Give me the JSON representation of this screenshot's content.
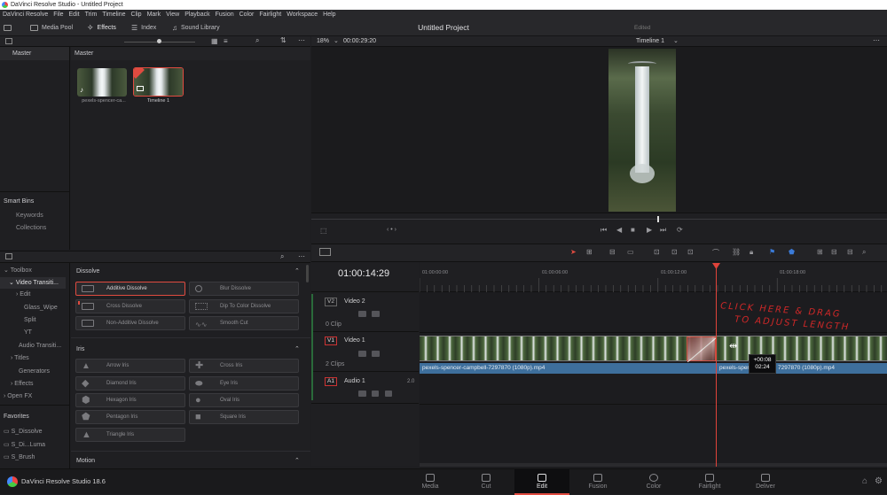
{
  "app": {
    "title": "DaVinci Resolve Studio - Untitled Project"
  },
  "menu": [
    "DaVinci Resolve",
    "File",
    "Edit",
    "Trim",
    "Timeline",
    "Clip",
    "Mark",
    "View",
    "Playback",
    "Fusion",
    "Color",
    "Fairlight",
    "Workspace",
    "Help"
  ],
  "toolbar": {
    "media_pool": "Media Pool",
    "effects": "Effects",
    "index": "Index",
    "sound_library": "Sound Library",
    "project_name": "Untitled Project",
    "edited": "Edited"
  },
  "viewer": {
    "zoom": "18%",
    "duration": "00:00:29:20",
    "timeline_name": "Timeline 1"
  },
  "media_pool": {
    "bin_tree_header": "Master",
    "bin_header": "Master",
    "clips": [
      {
        "name": "pexels-spencer-ca..."
      },
      {
        "name": "Timeline 1"
      }
    ],
    "smart_bins": "Smart Bins",
    "keywords": "Keywords",
    "collections": "Collections"
  },
  "effects_tree": {
    "toolbox": "Toolbox",
    "video_transitions": "Video Transiti...",
    "edit": "Edit",
    "glass_wipe": "Glass_Wipe",
    "split": "Split",
    "yt": "YT",
    "audio_transitions": "Audio Transiti...",
    "titles": "Titles",
    "generators": "Generators",
    "effects": "Effects",
    "open_fx": "Open FX",
    "favorites": "Favorites",
    "fav_items": [
      "S_Dissolve",
      "S_Di...Luma",
      "S_Brush"
    ]
  },
  "effects_library": {
    "dissolve_header": "Dissolve",
    "dissolve_items": [
      "Additive Dissolve",
      "Blur Dissolve",
      "Cross Dissolve",
      "Dip To Color Dissolve",
      "Non-Additive Dissolve",
      "Smooth Cut"
    ],
    "iris_header": "Iris",
    "iris_items": [
      "Arrow Iris",
      "Cross Iris",
      "Diamond Iris",
      "Eye Iris",
      "Hexagon Iris",
      "Oval Iris",
      "Pentagon Iris",
      "Square Iris",
      "Triangle Iris"
    ],
    "motion_header": "Motion"
  },
  "timeline": {
    "timecode": "01:00:14:29",
    "ruler": [
      "01:00:00:00",
      "01:00:06:00",
      "01:00:12:00",
      "01:00:18:00"
    ],
    "tracks": [
      {
        "id": "V2",
        "name": "Video 2",
        "clips": "0 Clip"
      },
      {
        "id": "V1",
        "name": "Video 1",
        "clips": "2 Clips"
      },
      {
        "id": "A1",
        "name": "Audio 1",
        "channel": "2.0"
      }
    ],
    "clip_a": "pexels-spencer-campbell-7297870 (1080p).mp4",
    "clip_b_start": "pexels-spence",
    "clip_b_end": "7297870 (1080p).mp4",
    "tooltip_offset": "+00:08",
    "tooltip_time": "02:24",
    "annotation_line1": "CLICK HERE & DRAG",
    "annotation_line2": "TO ADJUST LENGTH"
  },
  "pages": [
    "Media",
    "Cut",
    "Edit",
    "Fusion",
    "Color",
    "Fairlight",
    "Deliver"
  ],
  "footer": {
    "product": "DaVinci Resolve Studio 18.6"
  },
  "colors": {
    "playhead": "#e0433a",
    "clip_label": "#3e6f9c",
    "accent": "#e04b40"
  }
}
